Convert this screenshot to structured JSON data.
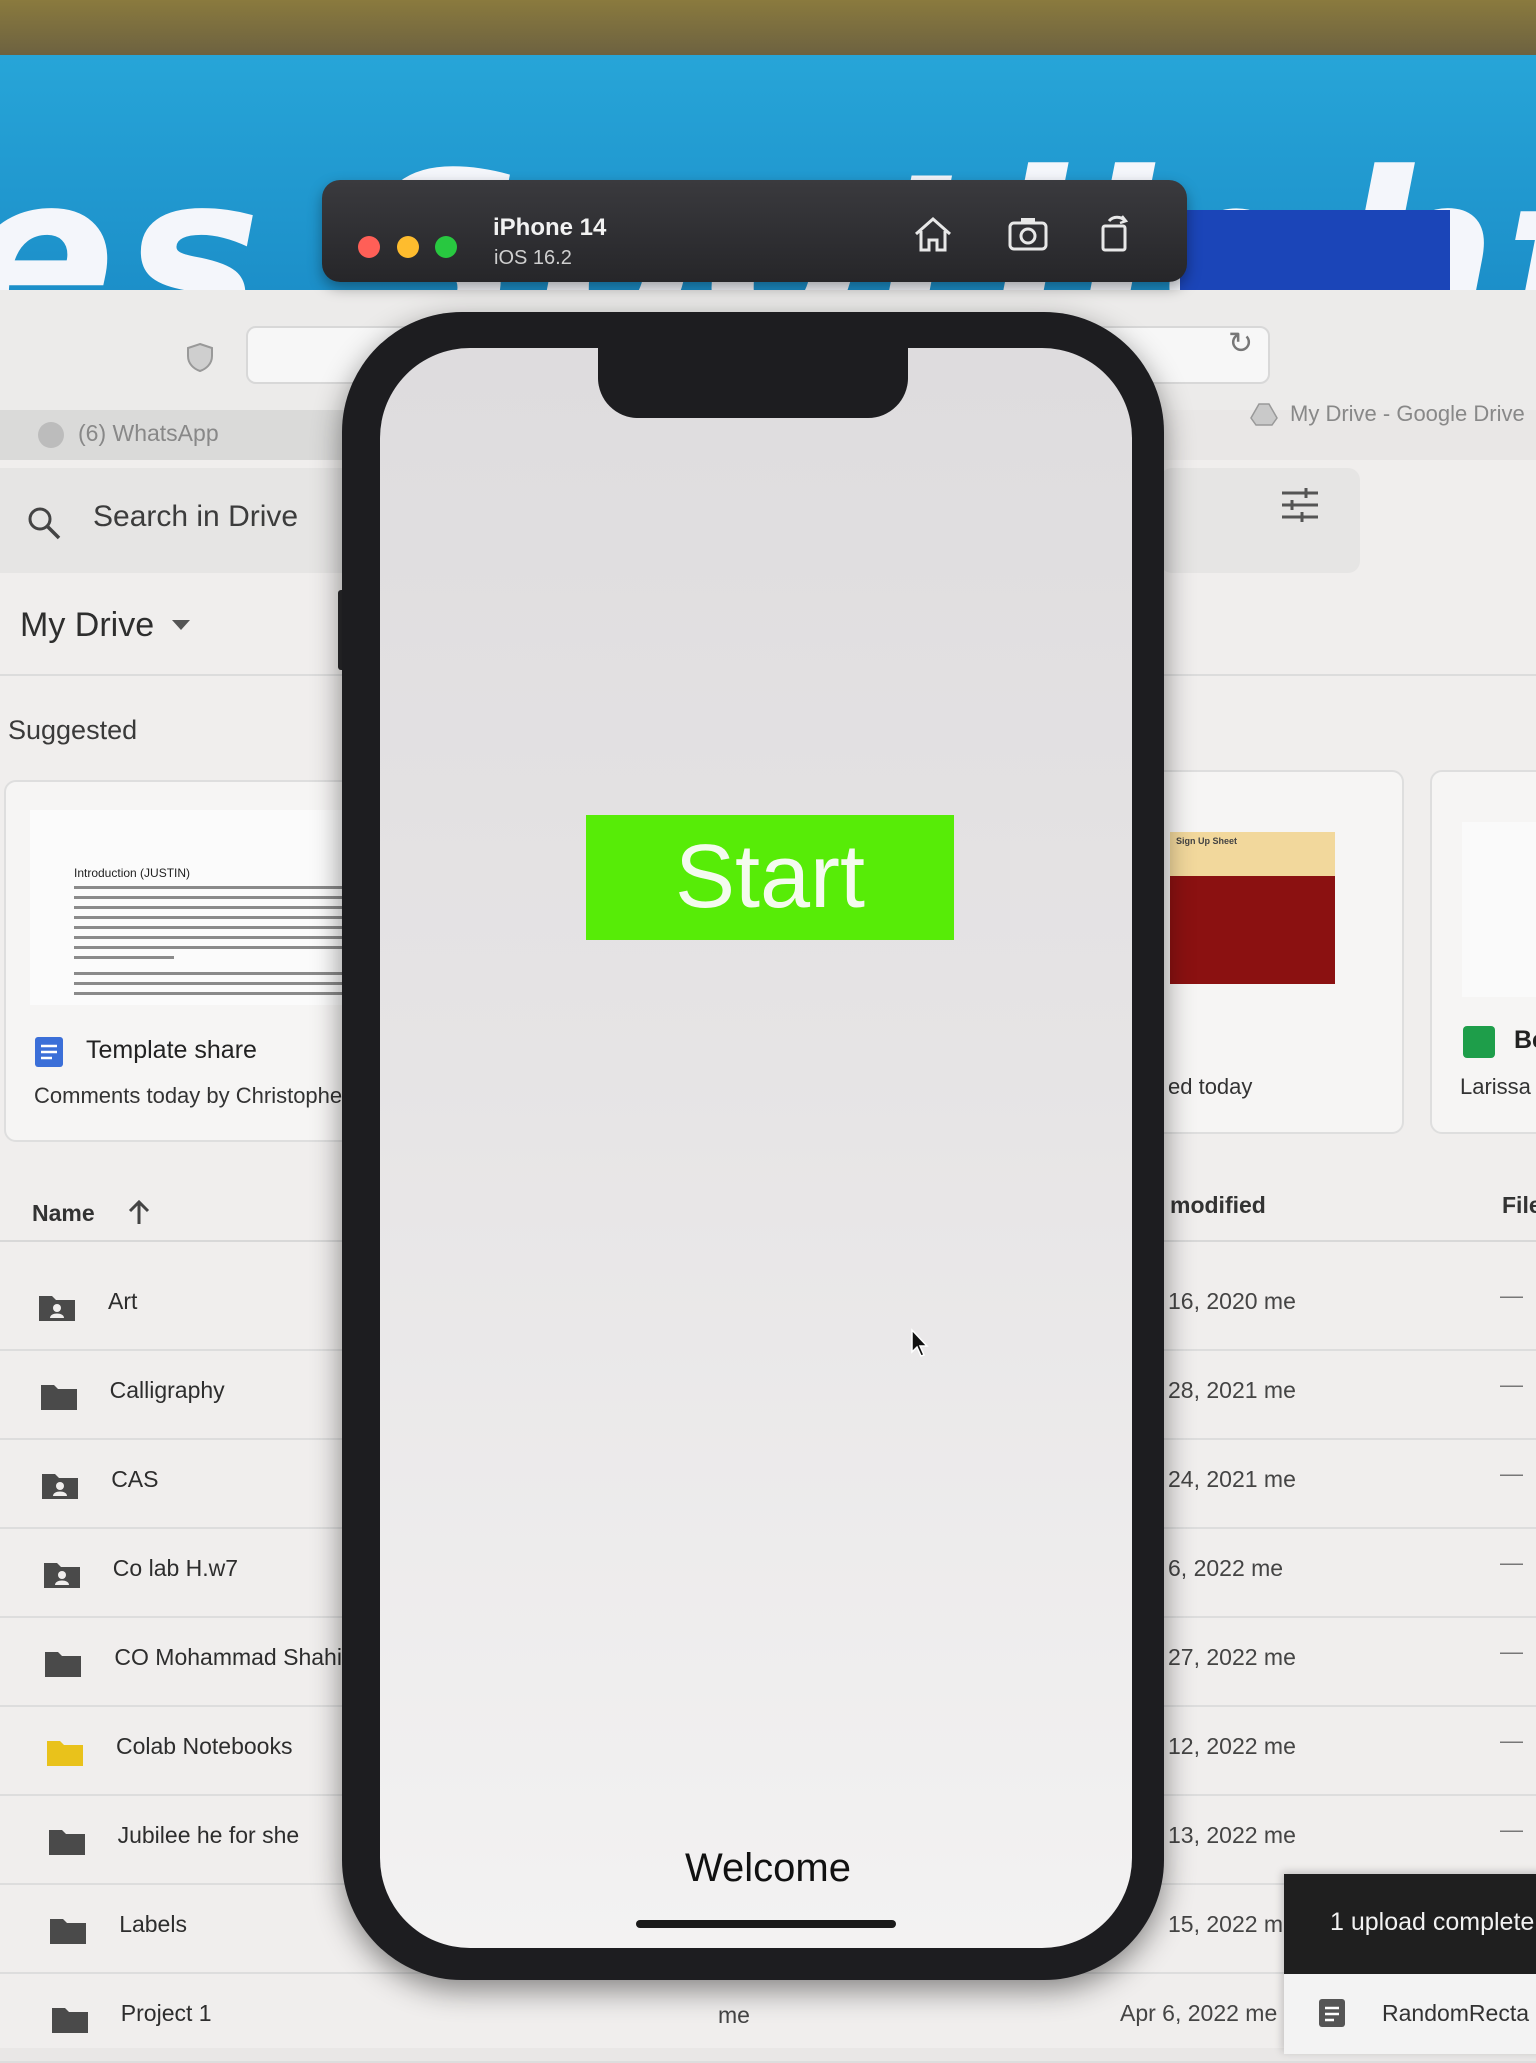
{
  "banner": {
    "text": "es Spotlight"
  },
  "browser": {
    "tab_left": "(6) WhatsApp",
    "tab_right": "My Drive - Google Drive"
  },
  "drive": {
    "search_placeholder": "Search in Drive",
    "location": "My Drive",
    "suggested_label": "Suggested",
    "cards": [
      {
        "doc_heading": "Introduction (JUSTIN)",
        "title": "Template share",
        "subtitle": "Comments today by Christopher"
      },
      {
        "thumb_title": "Sign Up Sheet",
        "subtitle": "ed today"
      },
      {
        "title": "Be",
        "subtitle": "Larissa"
      }
    ],
    "columns": {
      "name": "Name",
      "modified": "modified",
      "file_size": "File"
    },
    "rows": [
      {
        "name": "Art",
        "modified": "16, 2020 me",
        "size": "—",
        "icon": "shared-folder-icon"
      },
      {
        "name": "Calligraphy",
        "modified": "28, 2021 me",
        "size": "—",
        "icon": "folder-icon"
      },
      {
        "name": "CAS",
        "modified": "24, 2021 me",
        "size": "—",
        "icon": "shared-folder-icon"
      },
      {
        "name": "Co lab H.w7",
        "modified": "6, 2022 me",
        "size": "—",
        "icon": "shared-folder-icon"
      },
      {
        "name": "CO Mohammad Shahin",
        "modified": "27, 2022 me",
        "size": "—",
        "icon": "folder-icon"
      },
      {
        "name": "Colab Notebooks",
        "modified": "12, 2022 me",
        "size": "—",
        "icon": "yellow-folder-icon"
      },
      {
        "name": "Jubilee he for she",
        "modified": "13, 2022 me",
        "size": "—",
        "icon": "folder-icon"
      },
      {
        "name": "Labels",
        "modified": "15, 2022 m",
        "size": "",
        "icon": "folder-icon"
      },
      {
        "name": "Project 1",
        "owner": "me",
        "modified": "Apr 6, 2022 me",
        "size": "",
        "icon": "folder-icon"
      }
    ],
    "toast": {
      "title": "1 upload complete",
      "file": "RandomRecta"
    }
  },
  "simulator": {
    "device": "iPhone 14",
    "os": "iOS 16.2",
    "colors": {
      "close": "#ff5f57",
      "minimize": "#febc2e",
      "zoom": "#28c840"
    },
    "buttons": [
      "home-icon",
      "screenshot-icon",
      "rotate-icon"
    ]
  },
  "app": {
    "start_label": "Start",
    "start_color": "#57ec07",
    "welcome_label": "Welcome"
  }
}
